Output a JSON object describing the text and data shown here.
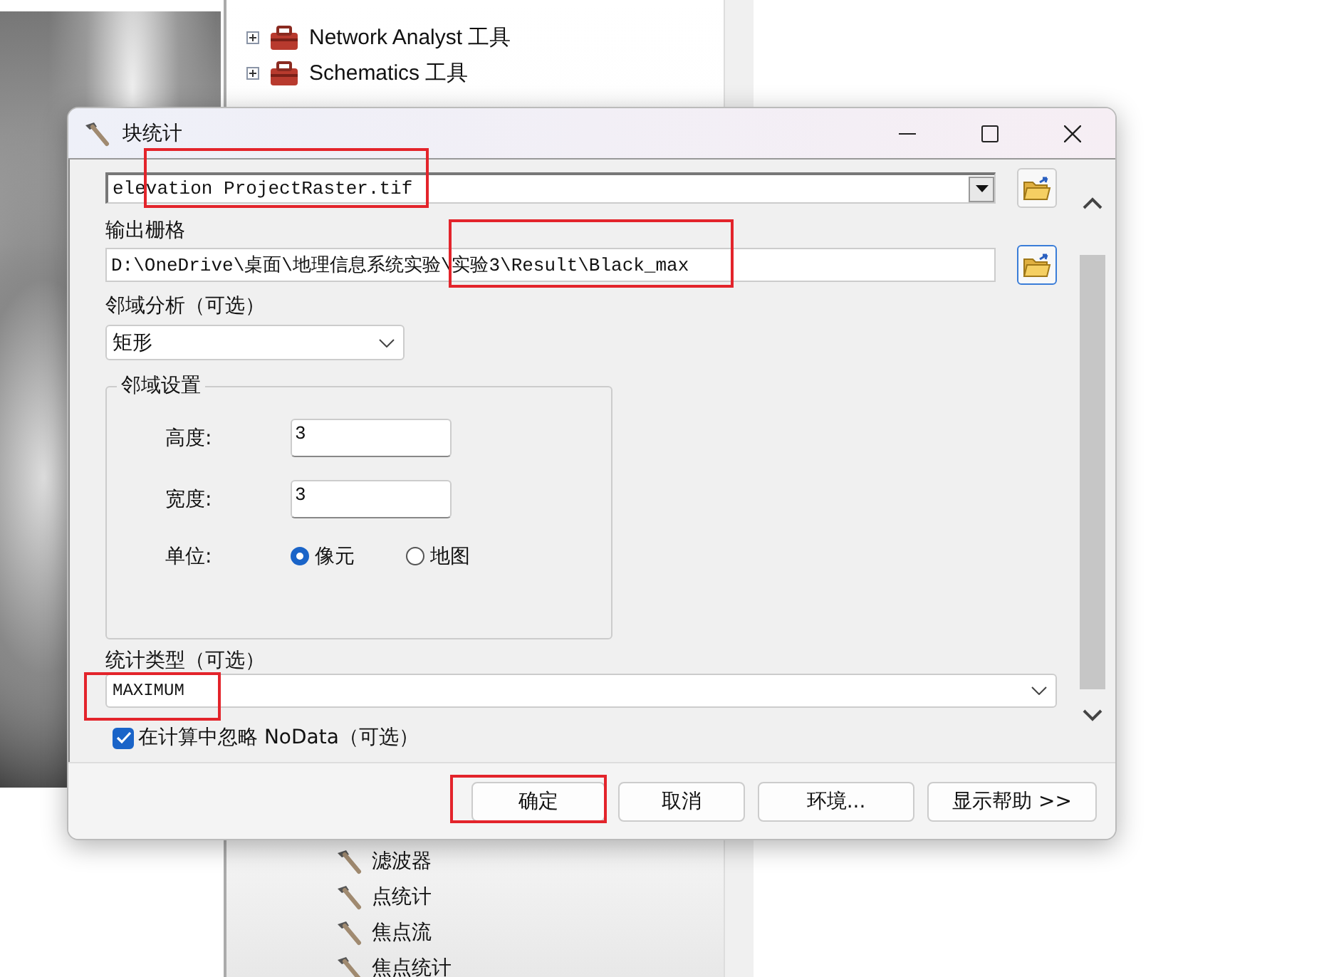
{
  "toolbox": {
    "top_items": [
      {
        "label": "Network Analyst 工具",
        "expanded": false
      },
      {
        "label": "Schematics 工具",
        "expanded": false
      }
    ],
    "bottom_items": [
      {
        "label": "滤波器"
      },
      {
        "label": "点统计"
      },
      {
        "label": "焦点流"
      },
      {
        "label": "焦点统计"
      }
    ]
  },
  "dialog": {
    "title": "块统计",
    "input_raster": {
      "value": "elevation ProjectRaster.tif",
      "highlighted": true
    },
    "output_raster": {
      "label": "输出栅格",
      "value": "D:\\OneDrive\\桌面\\地理信息系统实验\\实验3\\Result\\Black_max",
      "highlighted": true
    },
    "neighborhood": {
      "label": "邻域分析（可选）",
      "value": "矩形"
    },
    "neighborhood_settings": {
      "legend": "邻域设置",
      "fields": [
        {
          "label": "高度:",
          "value": "3"
        },
        {
          "label": "宽度:",
          "value": "3"
        }
      ],
      "units": {
        "label": "单位:",
        "options": [
          {
            "label": "像元",
            "selected": true
          },
          {
            "label": "地图",
            "selected": false
          }
        ]
      }
    },
    "statistics_type": {
      "label": "统计类型（可选）",
      "value": "MAXIMUM",
      "highlighted": true
    },
    "ignore_nodata": {
      "label": "在计算中忽略 NoData（可选）",
      "checked": true
    },
    "buttons": [
      {
        "label": "确定",
        "highlighted": true
      },
      {
        "label": "取消",
        "highlighted": false
      },
      {
        "label": "环境...",
        "highlighted": false
      },
      {
        "label": "显示帮助 >>",
        "highlighted": false
      }
    ]
  }
}
